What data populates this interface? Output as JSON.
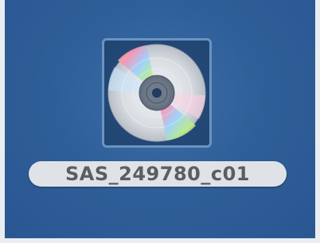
{
  "desktop": {
    "icon": {
      "name": "SAS_249780_c01",
      "type_icon": "optical-disc-icon",
      "selected": true
    }
  },
  "colors": {
    "desktop_background": "#2f5f98",
    "selection_border": "#6a93c4",
    "label_background": "#dfe3e8",
    "label_text": "#5a5e63"
  }
}
